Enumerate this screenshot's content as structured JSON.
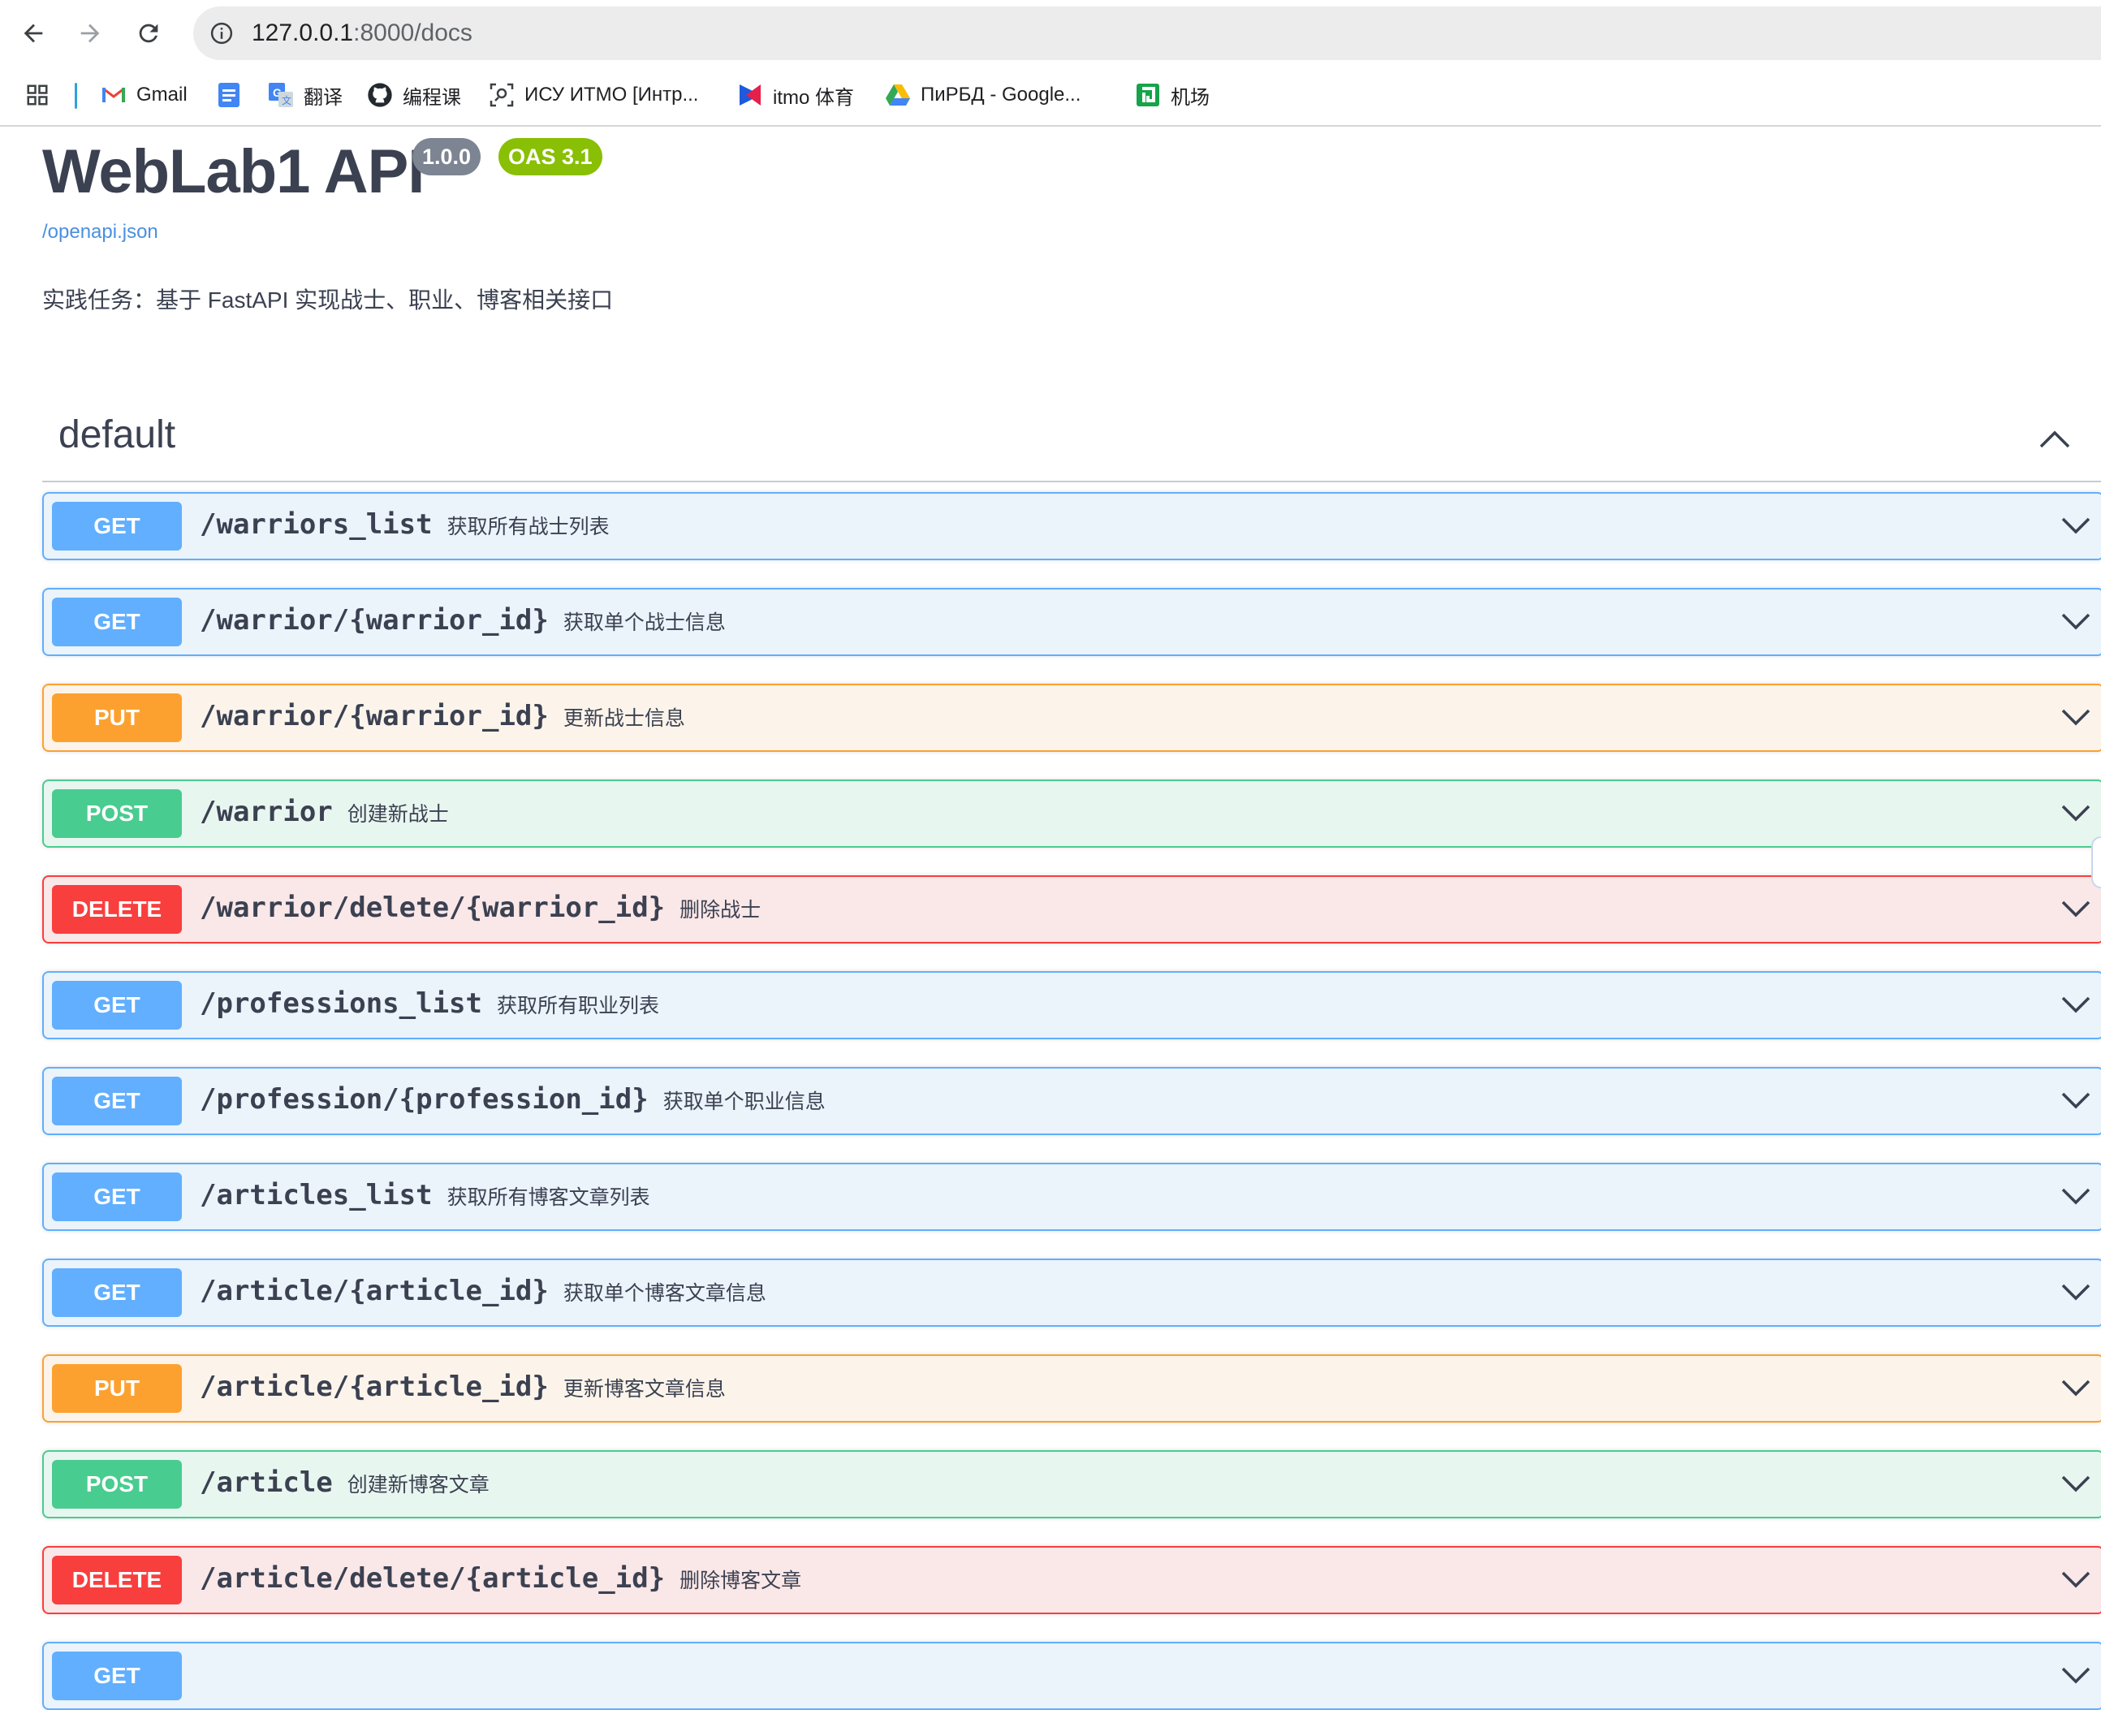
{
  "browser": {
    "url_host": "127.0.0.1",
    "url_path": ":8000/docs",
    "back_icon": "arrow-left-icon",
    "forward_icon": "arrow-right-icon",
    "reload_icon": "reload-icon",
    "site_info_icon": "info-icon"
  },
  "bookmarks": [
    {
      "label": "Gmail",
      "icon": "gmail-icon"
    },
    {
      "label": "",
      "icon": "docs-icon"
    },
    {
      "label": "翻译",
      "icon": "translate-icon"
    },
    {
      "label": "编程课",
      "icon": "github-icon"
    },
    {
      "label": "ИСУ ИТМО [Интр...",
      "icon": "link-icon"
    },
    {
      "label": "itmo 体育",
      "icon": "itmo-icon"
    },
    {
      "label": "ПиРБД - Google...",
      "icon": "drive-icon"
    },
    {
      "label": "机场",
      "icon": "airport-icon"
    }
  ],
  "info": {
    "title": "WebLab1 API",
    "version": "1.0.0",
    "oas": "OAS 3.1",
    "spec_link": "/openapi.json",
    "description": "实践任务：基于 FastAPI 实现战士、职业、博客相关接口"
  },
  "tag": {
    "name": "default"
  },
  "operations": [
    {
      "method": "GET",
      "path": "/warriors_list",
      "summary": "获取所有战士列表"
    },
    {
      "method": "GET",
      "path": "/warrior/{warrior_id}",
      "summary": "获取单个战士信息"
    },
    {
      "method": "PUT",
      "path": "/warrior/{warrior_id}",
      "summary": "更新战士信息"
    },
    {
      "method": "POST",
      "path": "/warrior",
      "summary": "创建新战士"
    },
    {
      "method": "DELETE",
      "path": "/warrior/delete/{warrior_id}",
      "summary": "删除战士"
    },
    {
      "method": "GET",
      "path": "/professions_list",
      "summary": "获取所有职业列表"
    },
    {
      "method": "GET",
      "path": "/profession/{profession_id}",
      "summary": "获取单个职业信息"
    },
    {
      "method": "GET",
      "path": "/articles_list",
      "summary": "获取所有博客文章列表"
    },
    {
      "method": "GET",
      "path": "/article/{article_id}",
      "summary": "获取单个博客文章信息"
    },
    {
      "method": "PUT",
      "path": "/article/{article_id}",
      "summary": "更新博客文章信息"
    },
    {
      "method": "POST",
      "path": "/article",
      "summary": "创建新博客文章"
    },
    {
      "method": "DELETE",
      "path": "/article/delete/{article_id}",
      "summary": "删除博客文章"
    },
    {
      "method": "GET",
      "path": "",
      "summary": ""
    }
  ],
  "colors": {
    "get": "#61affe",
    "put": "#fca130",
    "post": "#49cc90",
    "delete": "#f93e3e",
    "link": "#4990e2"
  }
}
